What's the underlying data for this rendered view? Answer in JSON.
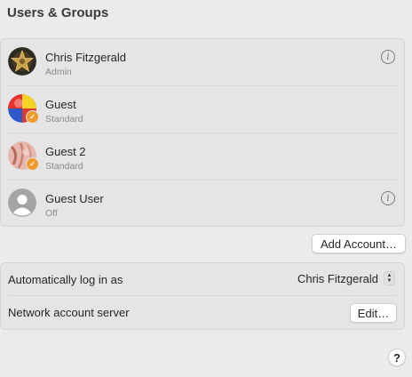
{
  "header": {
    "title": "Users & Groups"
  },
  "users": [
    {
      "name": "Chris Fitzgerald",
      "role": "Admin",
      "avatar": "star-avatar",
      "has_info": true,
      "has_badge": false
    },
    {
      "name": "Guest",
      "role": "Standard",
      "avatar": "ball-avatar",
      "has_info": false,
      "has_badge": true
    },
    {
      "name": "Guest 2",
      "role": "Standard",
      "avatar": "pink-avatar",
      "has_info": false,
      "has_badge": true
    },
    {
      "name": "Guest User",
      "role": "Off",
      "avatar": "generic-person-avatar",
      "has_info": true,
      "has_badge": false
    }
  ],
  "buttons": {
    "add_account": "Add Account…",
    "edit": "Edit…",
    "help": "?"
  },
  "settings": {
    "auto_login_label": "Automatically log in as",
    "auto_login_value": "Chris Fitzgerald",
    "network_server_label": "Network account server"
  },
  "colors": {
    "background": "#ebebeb",
    "panel": "#e5e5e5",
    "badge": "#f09a2d"
  }
}
